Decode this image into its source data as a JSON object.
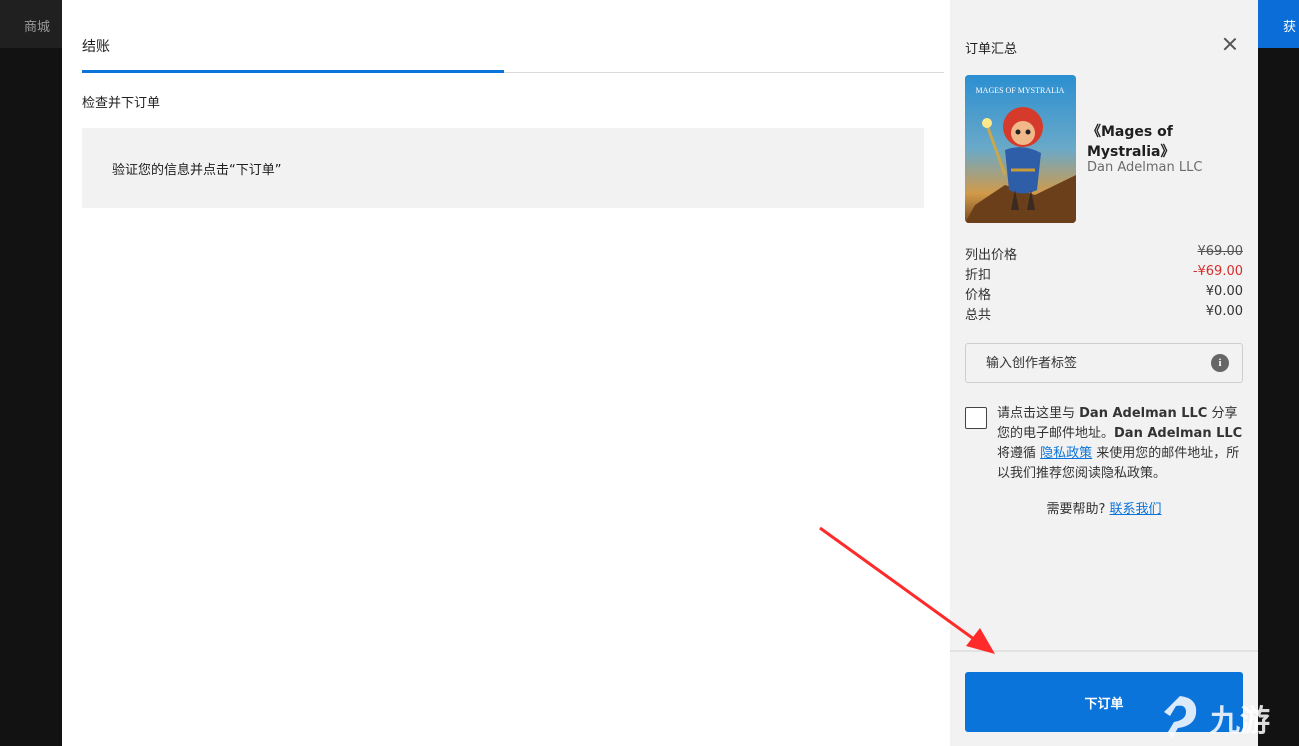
{
  "background": {
    "store_label": "商城",
    "get_label": "获"
  },
  "checkout": {
    "tab_label": "结账",
    "section_title": "检查并下订单",
    "info_text": "验证您的信息并点击“下订单”"
  },
  "summary": {
    "title": "订单汇总",
    "game": {
      "name": "《Mages of Mystralia》",
      "publisher": "Dan Adelman LLC",
      "cover_text": "MAGES OF MYSTRALIA"
    },
    "prices": [
      {
        "label": "列出价格",
        "value": "¥69.00",
        "style": "strike"
      },
      {
        "label": "折扣",
        "value": "-¥69.00",
        "style": "discount"
      },
      {
        "label": "价格",
        "value": "¥0.00",
        "style": "normal"
      },
      {
        "label": "总共",
        "value": "¥0.00",
        "style": "normal"
      }
    ],
    "creator_tag_placeholder": "输入创作者标签",
    "consent": {
      "part1": "请点击这里与 ",
      "company1": "Dan Adelman LLC",
      "part2": " 分享您的电子邮件地址。",
      "company2": "Dan Adelman LLC",
      "part3": " 将遵循 ",
      "privacy_link": "隐私政策",
      "part4": " 来使用您的邮件地址，所以我们推荐您阅读隐私政策。"
    },
    "help_text": "需要帮助?",
    "contact_link": "联系我们",
    "order_button": "下订单"
  },
  "watermark": {
    "text": "九游"
  },
  "colors": {
    "accent": "#0a74da",
    "discount": "#d62d2d",
    "arrow": "#ff2a2a"
  }
}
